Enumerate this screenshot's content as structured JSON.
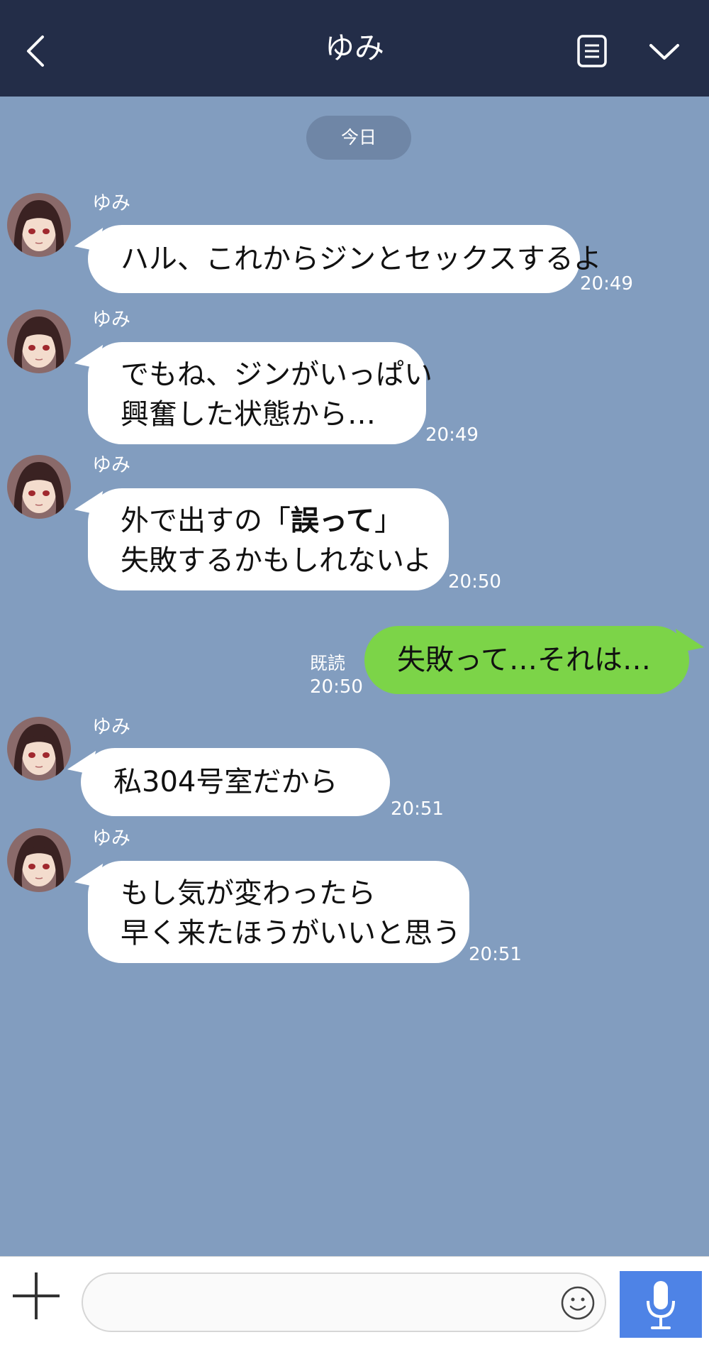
{
  "header": {
    "title": "ゆみ",
    "back_icon": "chevron-left-icon",
    "notes_icon": "document-icon",
    "menu_icon": "chevron-down-icon",
    "background": "#232d48"
  },
  "date_divider": "今日",
  "messages": [
    {
      "sender": "ゆみ",
      "lines": [
        "ハル、これからジンとセックスするよ"
      ],
      "time": "20:49"
    },
    {
      "sender": "ゆみ",
      "lines": [
        "でもね、ジンがいっぱい",
        "興奮した状態から…"
      ],
      "time": "20:49"
    },
    {
      "sender": "ゆみ",
      "lines": [
        "外で出すの「",
        "誤って",
        "」",
        "失敗するかもしれないよ"
      ],
      "time": "20:50"
    },
    {
      "sender": "me",
      "lines": [
        "失敗って…それは…"
      ],
      "read": "既読",
      "time": "20:50"
    },
    {
      "sender": "ゆみ",
      "lines": [
        "私304号室だから"
      ],
      "time": "20:51"
    },
    {
      "sender": "ゆみ",
      "lines": [
        "もし気が変わったら",
        "早く来たほうがいいと思う"
      ],
      "time": "20:51"
    }
  ],
  "composer": {
    "input_value": "",
    "input_placeholder": "",
    "plus_icon": "plus-icon",
    "emoji_icon": "smiley-icon",
    "mic_icon": "microphone-icon",
    "mic_color": "#4e83e6"
  },
  "colors": {
    "chat_background": "#829dbf",
    "incoming_bubble": "#ffffff",
    "outgoing_bubble": "#7cd448"
  }
}
